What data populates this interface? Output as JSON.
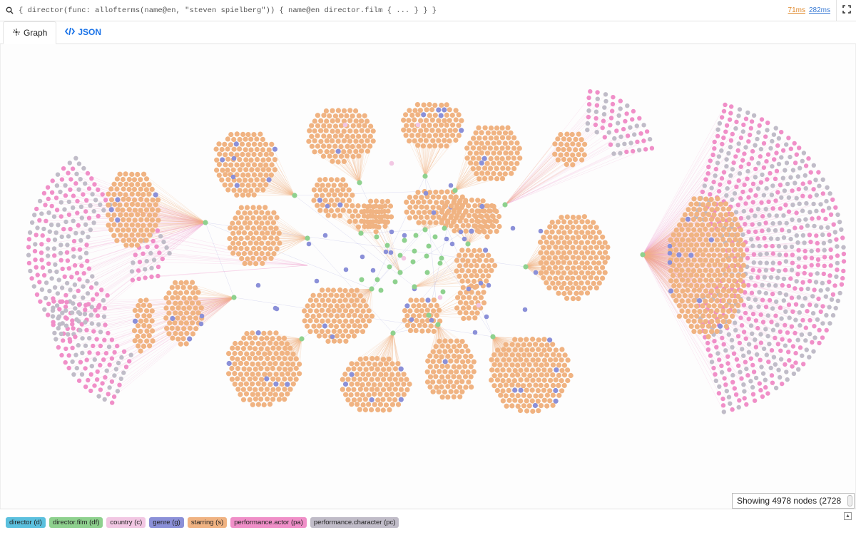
{
  "query": {
    "text": "{ director(func: allofterms(name@en, \"steven spielberg\")) { name@en director.film { ... } } }",
    "latency_server": "71ms",
    "latency_total": "282ms"
  },
  "tabs": [
    {
      "label": "Graph",
      "active": true
    },
    {
      "label": "JSON",
      "active": false
    }
  ],
  "status": {
    "text": "Showing 4978 nodes (2728"
  },
  "legend": [
    {
      "label": "director (d)",
      "color": "#5bc0de"
    },
    {
      "label": "director.film (df)",
      "color": "#8ed18e"
    },
    {
      "label": "country (c)",
      "color": "#f2c7e3"
    },
    {
      "label": "genre (g)",
      "color": "#8b90d8"
    },
    {
      "label": "starring (s)",
      "color": "#f0b382"
    },
    {
      "label": "performance.actor (pa)",
      "color": "#f08fc8"
    },
    {
      "label": "performance.character (pc)",
      "color": "#c0bcc8"
    }
  ],
  "colors": {
    "film": "#8ed18e",
    "starring": "#f0b382",
    "genre": "#8b90d8",
    "actor": "#f08fc8",
    "character": "#c0bcc8",
    "country": "#f2c7e3"
  }
}
